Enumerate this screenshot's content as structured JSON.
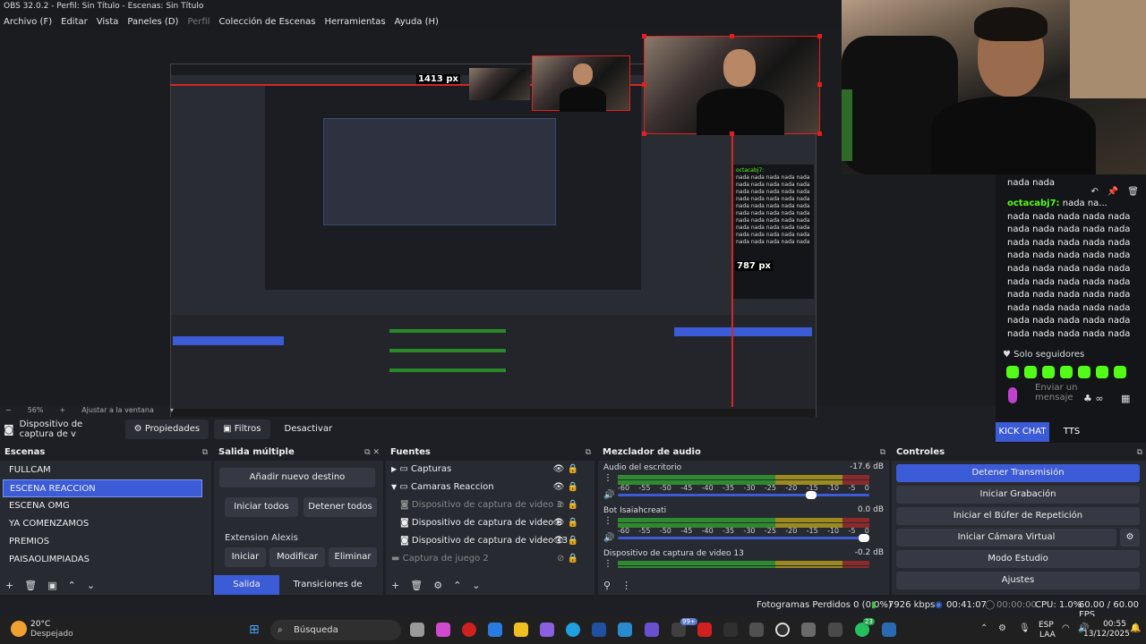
{
  "window": {
    "title": "OBS 32.0.2 - Perfil: Sin Título - Escenas: Sin Título"
  },
  "menu": [
    "Archivo (F)",
    "Editar",
    "Vista",
    "Paneles (D)",
    "Perfil",
    "Colección de Escenas",
    "Herramientas",
    "Ayuda (H)"
  ],
  "preview": {
    "overlay_px_label_1": "1413 px",
    "overlay_px_label_2": "787 px",
    "zoom": "56%",
    "fit_label": "Ajustar a la ventana"
  },
  "chat": {
    "prev_line": "nada nada",
    "username": "octacabj7:",
    "first_text": " nada na...",
    "lines": [
      "nada nada nada nada nada",
      "nada nada nada nada nada",
      "nada nada nada nada nada",
      "nada nada nada nada nada",
      "nada nada nada nada nada",
      "nada nada nada nada nada",
      "nada nada nada nada nada",
      "nada nada nada nada nada",
      "nada nada nada nada nada",
      "nada nada nada nada nada"
    ],
    "followers_only": "Solo seguidores",
    "send_placeholder": "Enviar un mensaje",
    "tab_kick": "KICK CHAT",
    "tab_tts": "TTS",
    "accent": "#53fc18"
  },
  "context": {
    "source_name": "Dispositivo de captura de v",
    "properties": "Propiedades",
    "filters": "Filtros",
    "deactivate": "Desactivar"
  },
  "scenes": {
    "title": "Escenas",
    "items": [
      "FULLCAM",
      "ESCENA REACCION",
      "ESCENA OMG",
      "YA COMENZAMOS",
      "PREMIOS",
      "PAISAOLIMPIADAS"
    ],
    "selected_index": 1
  },
  "multi": {
    "title": "Salida múltiple",
    "add": "Añadir nuevo destino",
    "start_all": "Iniciar todos",
    "stop_all": "Detener todos",
    "ext": "Extension Alexis",
    "start": "Iniciar",
    "modify": "Modificar",
    "remove": "Eliminar",
    "tab_multi": "Salida múltiple",
    "tab_trans": "Transiciones de escena"
  },
  "sources": {
    "title": "Fuentes",
    "items": [
      {
        "label": "Capturas",
        "kind": "folder-collapsed"
      },
      {
        "label": "Camaras Reaccion",
        "kind": "folder-expanded"
      },
      {
        "label": "Dispositivo de captura de video 3",
        "kind": "child-dim"
      },
      {
        "label": "Dispositivo de captura de video 6",
        "kind": "child"
      },
      {
        "label": "Dispositivo de captura de video 13",
        "kind": "child"
      },
      {
        "label": "Captura de juego 2",
        "kind": "dim"
      }
    ]
  },
  "mixer": {
    "title": "Mezclador de audio",
    "scale": [
      "-60",
      "-55",
      "-50",
      "-45",
      "-40",
      "-35",
      "-30",
      "-25",
      "-20",
      "-15",
      "-10",
      "-5",
      "0"
    ],
    "channels": [
      {
        "name": "Audio del escritorio",
        "db": "-17.6 dB",
        "level": 0.79
      },
      {
        "name": "Bot Isaiahcreati",
        "db": "0.0 dB",
        "level": 1.0
      },
      {
        "name": "Dispositivo de captura de video 13",
        "db": "-0.2 dB",
        "level": 1.0
      }
    ]
  },
  "controls": {
    "title": "Controles",
    "stop_stream": "Detener Transmisión",
    "start_rec": "Iniciar Grabación",
    "replay": "Iniciar el Búfer de Repetición",
    "vcam": "Iniciar Cámara Virtual",
    "studio": "Modo Estudio",
    "settings": "Ajustes"
  },
  "status": {
    "dropped": "Fotogramas Perdidos 0 (0.0%)",
    "kbps": "7926 kbps",
    "live": "00:41:07",
    "rec": "00:00:00",
    "cpu": "CPU: 1.0%",
    "fps": "60.00 / 60.00 FPS"
  },
  "taskbar": {
    "temp": "20°C",
    "weather": "Despejado",
    "search": "Búsqueda",
    "lang": "ESP",
    "region": "LAA",
    "time": "00:55",
    "date": "13/12/2025",
    "badge_1": "99+",
    "badge_2": "23"
  }
}
